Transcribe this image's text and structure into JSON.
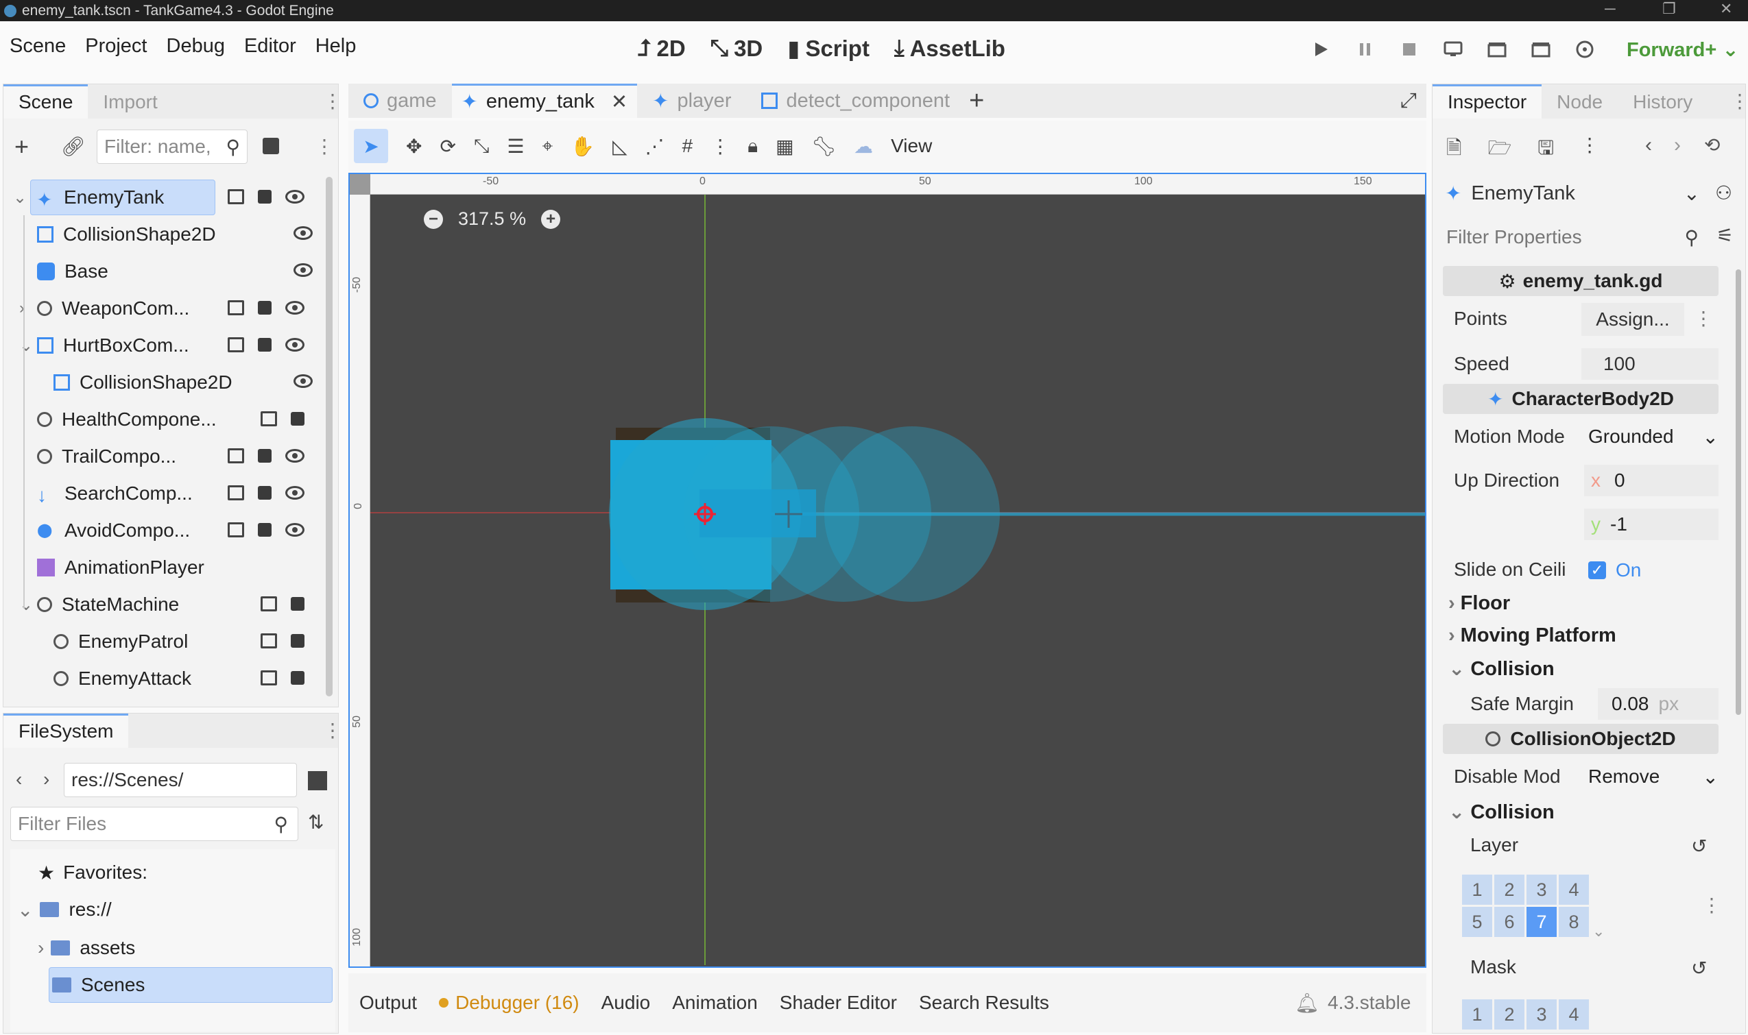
{
  "window": {
    "title": "enemy_tank.tscn - TankGame4.3 - Godot Engine"
  },
  "menu": [
    "Scene",
    "Project",
    "Debug",
    "Editor",
    "Help"
  ],
  "modes": {
    "m2d": "2D",
    "m3d": "3D",
    "script": "Script",
    "assetlib": "AssetLib"
  },
  "renderer": "Forward+",
  "scene_panel": {
    "tabs": [
      "Scene",
      "Import"
    ],
    "filter_placeholder": "Filter: name,",
    "nodes": [
      {
        "label": "EnemyTank",
        "icon": "character-body-icon"
      },
      {
        "label": "CollisionShape2D",
        "icon": "collision-shape-icon"
      },
      {
        "label": "Base",
        "icon": "sprite-icon"
      },
      {
        "label": "WeaponCom...",
        "icon": "node-icon"
      },
      {
        "label": "HurtBoxCom...",
        "icon": "area-icon"
      },
      {
        "label": "CollisionShape2D",
        "icon": "collision-shape-icon"
      },
      {
        "label": "HealthCompone...",
        "icon": "node-icon"
      },
      {
        "label": "TrailCompo...",
        "icon": "node-icon"
      },
      {
        "label": "SearchComp...",
        "icon": "raycast-icon"
      },
      {
        "label": "AvoidCompo...",
        "icon": "marker-icon"
      },
      {
        "label": "AnimationPlayer",
        "icon": "animation-icon"
      },
      {
        "label": "StateMachine",
        "icon": "node-icon"
      },
      {
        "label": "EnemyPatrol",
        "icon": "node-icon"
      },
      {
        "label": "EnemyAttack",
        "icon": "node-icon"
      }
    ]
  },
  "filesystem": {
    "tab": "FileSystem",
    "path": "res://Scenes/",
    "filter_placeholder": "Filter Files",
    "items": [
      "Favorites:",
      "res://",
      "assets",
      "Scenes"
    ]
  },
  "editor_tabs": [
    "game",
    "enemy_tank",
    "player",
    "detect_component"
  ],
  "viewport": {
    "zoom": "317.5 %",
    "view_label": "View",
    "ruler_h": [
      "-50",
      "0",
      "50",
      "100",
      "150"
    ],
    "ruler_v": [
      "-50",
      "0",
      "50",
      "100"
    ]
  },
  "bottom_tabs": {
    "output": "Output",
    "debugger": "Debugger (16)",
    "audio": "Audio",
    "animation": "Animation",
    "shader": "Shader Editor",
    "search": "Search Results",
    "version": "4.3.stable"
  },
  "inspector": {
    "tabs": [
      "Inspector",
      "Node",
      "History"
    ],
    "object": "EnemyTank",
    "filter_placeholder": "Filter Properties",
    "script_section": "enemy_tank.gd",
    "points_label": "Points",
    "points_value": "Assign...",
    "speed_label": "Speed",
    "speed_value": "100",
    "cb_section": "CharacterBody2D",
    "motion_label": "Motion Mode",
    "motion_value": "Grounded",
    "updir_label": "Up Direction",
    "x_label": "x",
    "x_value": "0",
    "y_label": "y",
    "y_value": "-1",
    "slide_label": "Slide on Ceili",
    "slide_value": "On",
    "floor": "Floor",
    "moving": "Moving Platform",
    "collision": "Collision",
    "safe_label": "Safe Margin",
    "safe_value": "0.08",
    "safe_unit": "px",
    "co_section": "CollisionObject2D",
    "disable_label": "Disable Mod",
    "disable_value": "Remove",
    "collision2": "Collision",
    "layer_label": "Layer",
    "layer_bits": [
      "1",
      "2",
      "3",
      "4",
      "5",
      "6",
      "7",
      "8"
    ],
    "mask_label": "Mask",
    "mask_bits": [
      "1",
      "2",
      "3",
      "4"
    ]
  }
}
